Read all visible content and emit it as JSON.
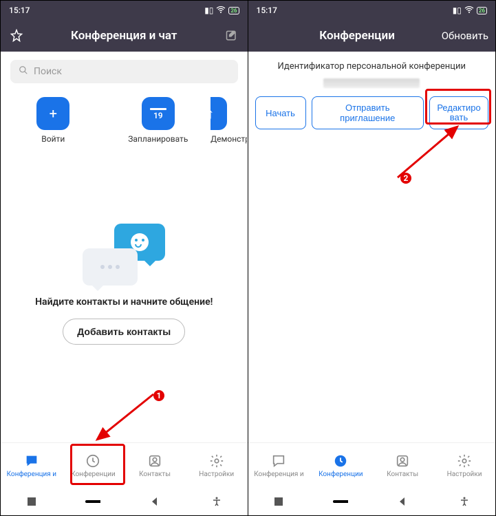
{
  "status": {
    "time": "15:17",
    "battery": "26"
  },
  "screen1": {
    "header_title": "Конференция и чат",
    "search_placeholder": "Поиск",
    "quick": {
      "join": {
        "label": "Войти"
      },
      "schedule": {
        "label": "Запланировать",
        "day": "19"
      },
      "demo": {
        "label": "Демонстраци"
      }
    },
    "empty_text": "Найдите контакты и начните общение!",
    "add_contacts": "Добавить контакты",
    "nav": {
      "chat": "Конференция и",
      "conf": "Конференции",
      "contacts": "Контакты",
      "settings": "Настройки"
    }
  },
  "screen2": {
    "header_title": "Конференции",
    "header_action": "Обновить",
    "id_label": "Идентификатор персональной конференции",
    "buttons": {
      "start": "Начать",
      "invite": "Отправить приглашение",
      "edit": "Редактиро вать"
    },
    "nav": {
      "chat": "Конференция и",
      "conf": "Конференции",
      "contacts": "Контакты",
      "settings": "Настройки"
    }
  },
  "annotations": {
    "step1": "1",
    "step2": "2"
  }
}
